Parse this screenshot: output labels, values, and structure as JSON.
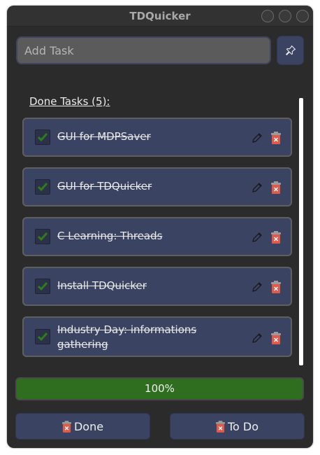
{
  "window": {
    "title": "TDQuicker"
  },
  "add_task": {
    "placeholder": "Add Task",
    "value": ""
  },
  "pin": {
    "icon": "pin-icon"
  },
  "done_section": {
    "label": "Done Tasks (5):"
  },
  "tasks": [
    {
      "text": "GUI for MDPSaver",
      "done": true
    },
    {
      "text": "GUI for TDQuicker",
      "done": true
    },
    {
      "text": "C Learning: Threads",
      "done": true
    },
    {
      "text": "Install TDQuicker",
      "done": true
    },
    {
      "text": "Industry Day: informations gathering",
      "done": true
    }
  ],
  "progress": {
    "value": 100,
    "label": "100%"
  },
  "buttons": {
    "done_label": "Done",
    "todo_label": "To Do"
  },
  "colors": {
    "window_bg": "#2b2b2b",
    "card_bg": "#3a4362",
    "progress_green": "#2e6e1e",
    "check_green": "#2e7d1a",
    "trash_red": "#e05a4a"
  }
}
